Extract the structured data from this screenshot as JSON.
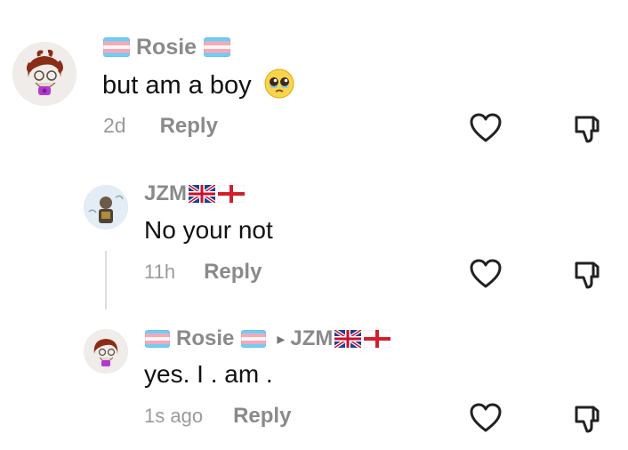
{
  "comments": [
    {
      "username": "Rosie",
      "text": "but am a boy",
      "emoji": "🥹",
      "time": "2d",
      "reply_label": "Reply"
    },
    {
      "username": "JZM",
      "text": "No your not",
      "time": "11h",
      "reply_label": "Reply"
    },
    {
      "username": "Rosie",
      "reply_to": "JZM",
      "text": "yes. I . am .",
      "time": "1s ago",
      "reply_label": "Reply"
    }
  ],
  "icons": {
    "like": "heart-icon",
    "dislike": "thumbs-down-icon"
  },
  "colors": {
    "meta_gray": "#8a8a8a",
    "text": "#111111",
    "icon": "#222222"
  }
}
